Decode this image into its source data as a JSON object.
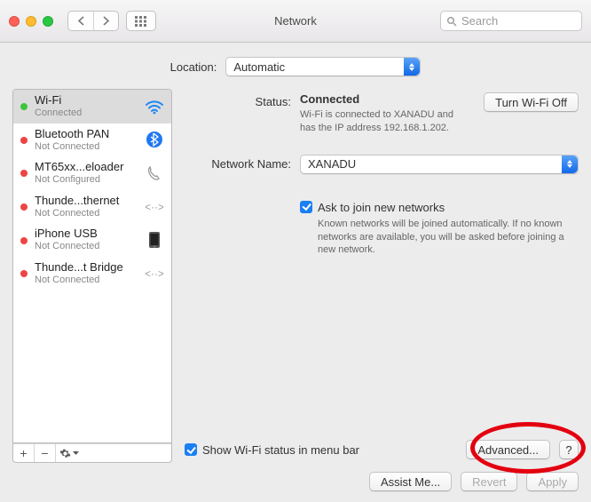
{
  "window": {
    "title": "Network"
  },
  "toolbar": {
    "search_placeholder": "Search"
  },
  "location": {
    "label": "Location:",
    "value": "Automatic"
  },
  "sidebar": {
    "items": [
      {
        "name": "Wi-Fi",
        "status": "Connected",
        "dot": "green",
        "icon": "wifi"
      },
      {
        "name": "Bluetooth PAN",
        "status": "Not Connected",
        "dot": "red",
        "icon": "bluetooth"
      },
      {
        "name": "MT65xx...eloader",
        "status": "Not Configured",
        "dot": "red",
        "icon": "phone"
      },
      {
        "name": "Thunde...thernet",
        "status": "Not Connected",
        "dot": "red",
        "icon": "thunderbolt"
      },
      {
        "name": "iPhone USB",
        "status": "Not Connected",
        "dot": "red",
        "icon": "iphone"
      },
      {
        "name": "Thunde...t Bridge",
        "status": "Not Connected",
        "dot": "red",
        "icon": "thunderbolt"
      }
    ],
    "tool_add": "+",
    "tool_remove": "−",
    "tool_gear": "⚙︎▾"
  },
  "detail": {
    "status_label": "Status:",
    "status_value": "Connected",
    "wifi_off_btn": "Turn Wi-Fi Off",
    "status_sub": "Wi-Fi is connected to XANADU and has the IP address 192.168.1.202.",
    "network_name_label": "Network Name:",
    "network_name_value": "XANADU",
    "ask_join_label": "Ask to join new networks",
    "ask_join_sub": "Known networks will be joined automatically. If no known networks are available, you will be asked before joining a new network.",
    "show_menubar_label": "Show Wi-Fi status in menu bar",
    "advanced_btn": "Advanced...",
    "help_btn": "?"
  },
  "footer": {
    "assist_btn": "Assist Me...",
    "revert_btn": "Revert",
    "apply_btn": "Apply"
  }
}
